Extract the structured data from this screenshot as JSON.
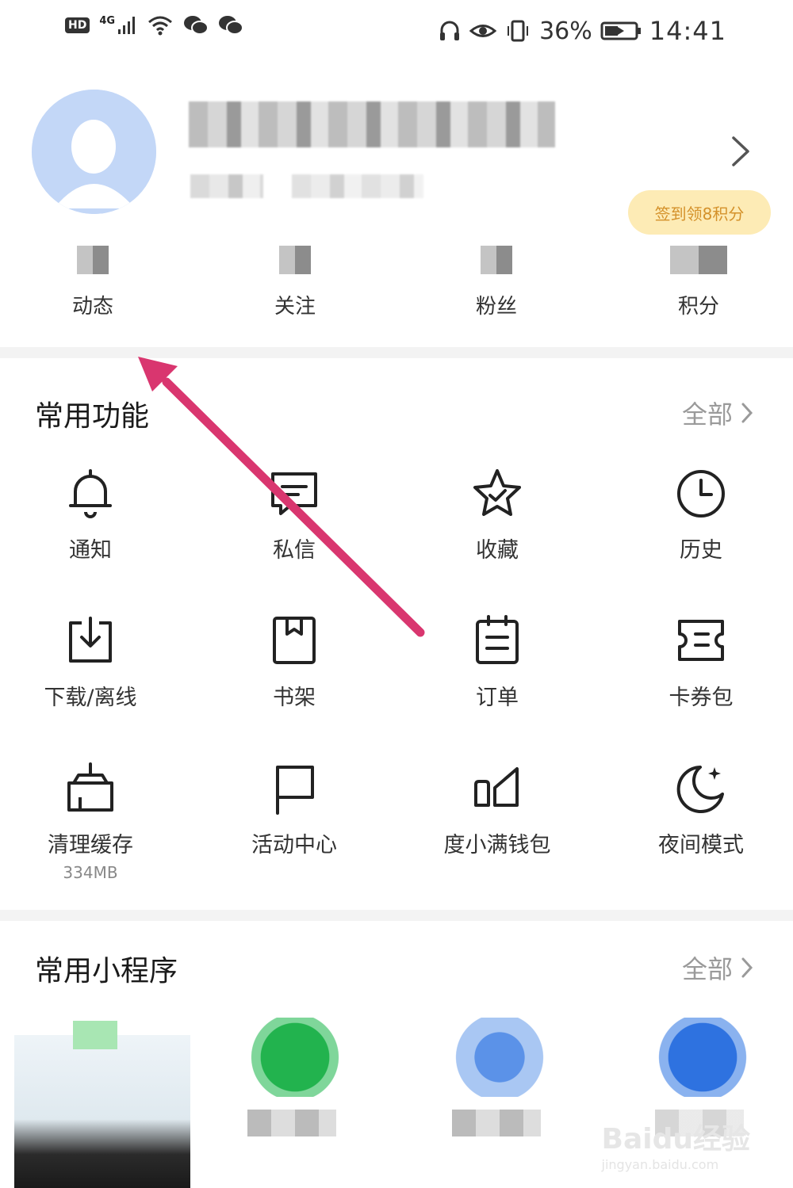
{
  "status_bar": {
    "hd_label": "HD",
    "network_label": "4G",
    "battery_percent": "36%",
    "time": "14:41",
    "icons": [
      "signal-icon",
      "wifi-icon",
      "wechat-icon",
      "wechat-icon",
      "headphones-icon",
      "eye-icon",
      "vibrate-icon",
      "battery-icon"
    ]
  },
  "profile": {
    "checkin_badge": "签到领8积分",
    "stats": [
      {
        "label": "动态"
      },
      {
        "label": "关注"
      },
      {
        "label": "粉丝"
      },
      {
        "label": "积分"
      }
    ]
  },
  "common_functions": {
    "title": "常用功能",
    "all_label": "全部",
    "items": [
      {
        "label": "通知",
        "icon": "bell-icon"
      },
      {
        "label": "私信",
        "icon": "message-icon"
      },
      {
        "label": "收藏",
        "icon": "star-icon"
      },
      {
        "label": "历史",
        "icon": "clock-icon"
      },
      {
        "label": "下载/离线",
        "icon": "download-icon"
      },
      {
        "label": "书架",
        "icon": "bookshelf-icon"
      },
      {
        "label": "订单",
        "icon": "order-icon"
      },
      {
        "label": "卡券包",
        "icon": "coupon-icon"
      },
      {
        "label": "清理缓存",
        "icon": "broom-icon",
        "sub": "334MB"
      },
      {
        "label": "活动中心",
        "icon": "flag-icon"
      },
      {
        "label": "度小满钱包",
        "icon": "wallet-icon"
      },
      {
        "label": "夜间模式",
        "icon": "moon-icon"
      }
    ]
  },
  "mini_programs": {
    "title": "常用小程序",
    "all_label": "全部"
  },
  "watermark": {
    "text": "Baidu经验",
    "sub": "jingyan.baidu.com"
  },
  "colors": {
    "annotation_arrow": "#d9366f",
    "avatar_bg": "#c3d7f7",
    "checkin_bg": "#fdebb5",
    "checkin_text": "#d4912a"
  }
}
